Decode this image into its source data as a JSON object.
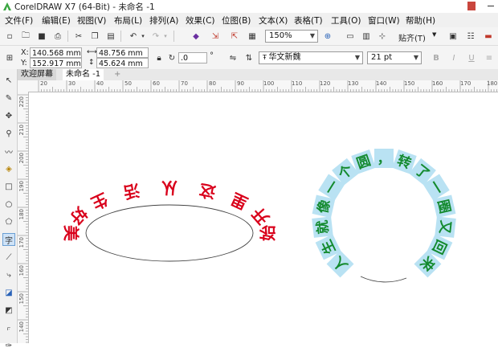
{
  "app": {
    "title": "CorelDRAW X7 (64-Bit) - 未命名 -1"
  },
  "menu": [
    "文件(F)",
    "编辑(E)",
    "视图(V)",
    "布局(L)",
    "排列(A)",
    "效果(C)",
    "位图(B)",
    "文本(X)",
    "表格(T)",
    "工具(O)",
    "窗口(W)",
    "帮助(H)"
  ],
  "toolbar": {
    "zoom": "150%",
    "snap_label": "贴齐(T)"
  },
  "property_bar": {
    "x": "140.568 mm",
    "y": "152.917 mm",
    "x_label": "X:",
    "y_label": "Y:",
    "width": "48.756 mm",
    "height": "45.624 mm",
    "rotation": ".0",
    "rotation_unit": "°",
    "font": "华文新魏",
    "font_size": "21 pt"
  },
  "tabs": [
    "欢迎屏幕",
    "未命名 -1",
    "+"
  ],
  "ruler": {
    "h_ticks": [
      "20",
      "30",
      "40",
      "50",
      "60",
      "70",
      "80",
      "90",
      "100",
      "110",
      "120",
      "130",
      "140",
      "150",
      "160",
      "170",
      "180"
    ],
    "v_ticks": [
      "220",
      "210",
      "200",
      "190",
      "180",
      "170",
      "160",
      "150",
      "140"
    ]
  },
  "canvas": {
    "ellipse_text": "美好生活从这里开始",
    "circle_text": "人生就像一个圆，转了一圈又回来",
    "colors": {
      "ellipse_text": "#d9001b",
      "circle_text": "#138a2e",
      "circle_highlight": "#b9e2f3"
    }
  }
}
